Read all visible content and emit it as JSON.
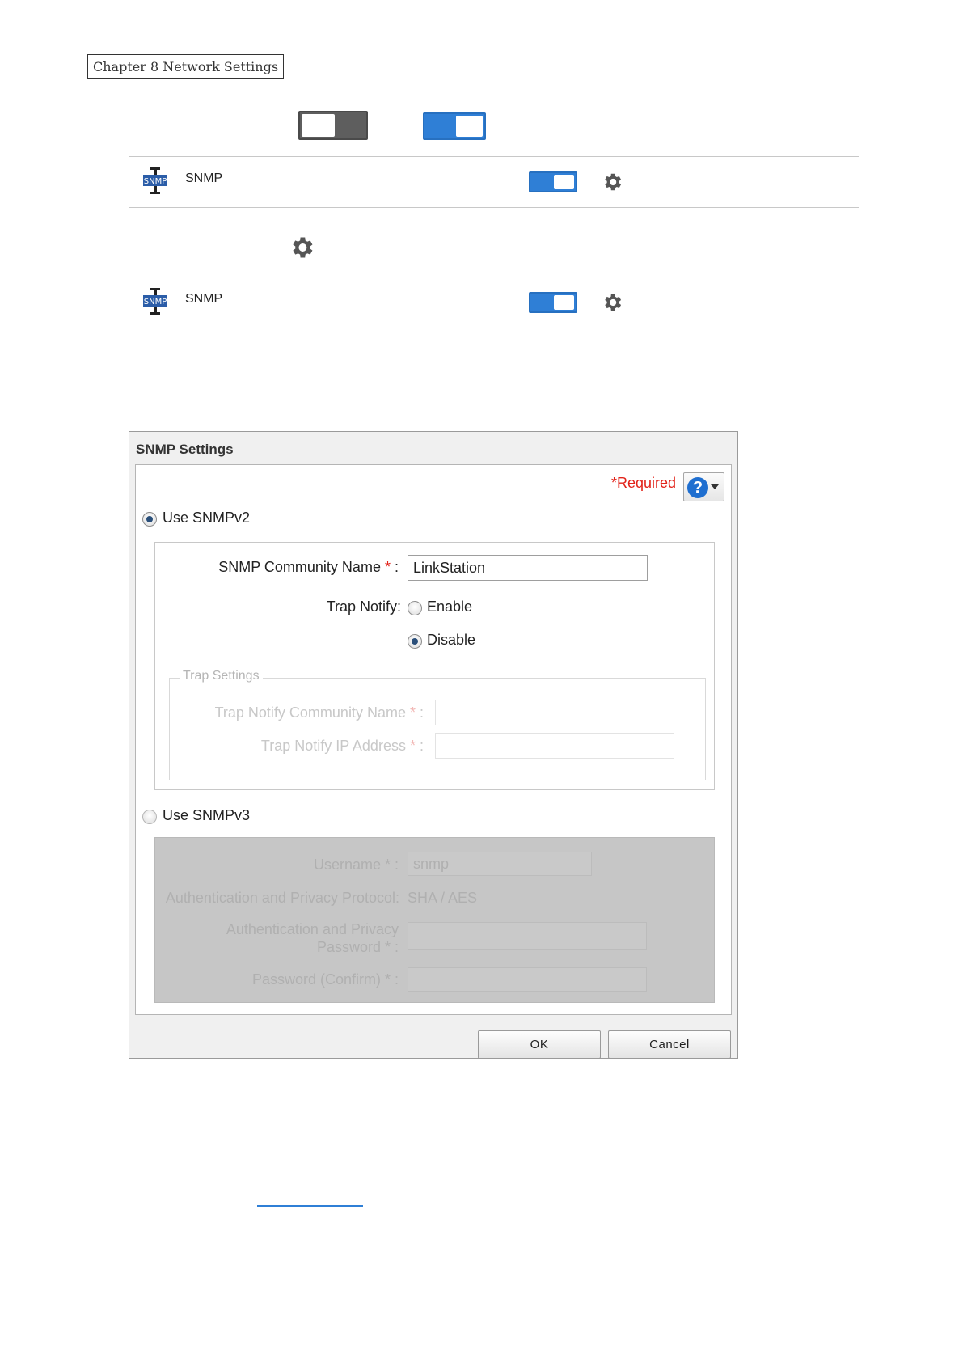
{
  "chapter": "Chapter 8 Network Settings",
  "rows": [
    {
      "label": "SNMP",
      "icon_text": "SNMP",
      "toggle": "on"
    },
    {
      "label": "SNMP",
      "icon_text": "SNMP",
      "toggle": "on"
    }
  ],
  "dialog": {
    "title": "SNMP Settings",
    "required": "*Required",
    "help_symbol": "?",
    "snmpv2": {
      "label": "Use SNMPv2",
      "selected": true,
      "community_label": "SNMP Community Name",
      "community_value": "LinkStation",
      "trap_notify_label": "Trap Notify:",
      "enable_label": "Enable",
      "disable_label": "Disable",
      "trap_selected": "Disable",
      "trap_settings": {
        "legend": "Trap Settings",
        "community_label": "Trap Notify Community Name",
        "ip_label": "Trap Notify IP Address"
      }
    },
    "snmpv3": {
      "label": "Use SNMPv3",
      "selected": false,
      "username_label": "Username",
      "username_value": "snmp",
      "protocol_label": "Authentication and Privacy Protocol:",
      "protocol_value": "SHA / AES",
      "password_label_1": "Authentication and Privacy",
      "password_label_2": "Password",
      "confirm_label": "Password (Confirm)"
    },
    "ok": "OK",
    "cancel": "Cancel"
  },
  "colors": {
    "toggle_on": "#2f7fd6",
    "toggle_off": "#5e5e5e",
    "required": "#e2231a",
    "help": "#1f6fd0"
  }
}
